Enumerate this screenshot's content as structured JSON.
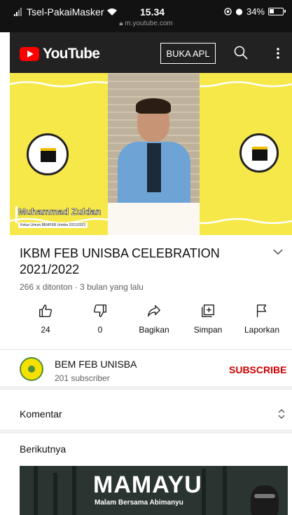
{
  "status_bar": {
    "carrier": "Tsel-PakaiMasker",
    "time": "15.34",
    "battery": "34%",
    "url": "m.youtube.com"
  },
  "header": {
    "logo_text": "YouTube",
    "open_app_label": "BUKA APL",
    "icons": [
      "search-icon",
      "more-vert-icon"
    ]
  },
  "video": {
    "speaker_name": "Muhammad Zuldan",
    "speaker_role": "Ketua Umum BEMFEB Unisba 2021/2022"
  },
  "details": {
    "title": "IKBM FEB UNISBA CELEBRATION 2021/2022",
    "meta": "266 x ditonton · 3 bulan yang lalu"
  },
  "actions": [
    {
      "label": "24",
      "icon": "like-icon"
    },
    {
      "label": "0",
      "icon": "dislike-icon"
    },
    {
      "label": "Bagikan",
      "icon": "share-icon"
    },
    {
      "label": "Simpan",
      "icon": "save-to-playlist-icon"
    },
    {
      "label": "Laporkan",
      "icon": "flag-icon"
    }
  ],
  "channel": {
    "name": "BEM FEB UNISBA",
    "subscribers": "201 subscriber",
    "subscribe_label": "SUBSCRIBE"
  },
  "comments": {
    "label": "Komentar"
  },
  "next": {
    "label": "Berikutnya",
    "thumb_title": "MAMAYU",
    "thumb_subtitle": "Malam Bersama Abimanyu"
  },
  "colors": {
    "youtube_red": "#ff0000",
    "subscribe_red": "#cc0000",
    "video_yellow": "#f7e84a",
    "header_bg": "#222222"
  }
}
